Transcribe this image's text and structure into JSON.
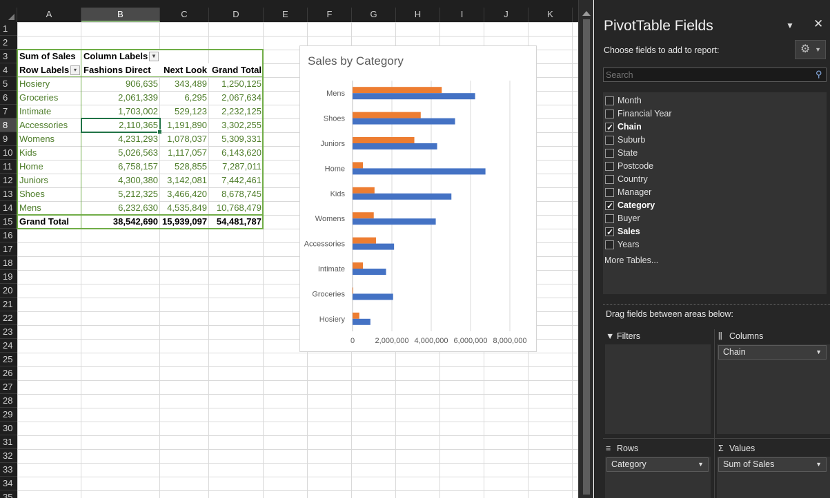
{
  "sheet": {
    "columns": [
      "A",
      "B",
      "C",
      "D",
      "E",
      "F",
      "G",
      "H",
      "I",
      "J",
      "K"
    ],
    "rows": [
      "1",
      "2",
      "3",
      "4",
      "5",
      "6",
      "7",
      "8",
      "9",
      "10",
      "11",
      "12",
      "13",
      "14",
      "15",
      "16",
      "17",
      "18",
      "19",
      "20",
      "21",
      "22",
      "23",
      "24",
      "25",
      "26",
      "27",
      "28",
      "29",
      "30",
      "31",
      "32",
      "33",
      "34",
      "35"
    ],
    "selected_column": "B",
    "selected_row": "8"
  },
  "pivot": {
    "header_sum": "Sum of Sales",
    "header_column_labels": "Column Labels",
    "header_row_labels": "Row Labels",
    "col1": "Fashions Direct",
    "col2": "Next Look",
    "col3": "Grand Total",
    "rows": [
      {
        "label": "Hosiery",
        "fd": "906,635",
        "nl": "343,489",
        "gt": "1,250,125"
      },
      {
        "label": "Groceries",
        "fd": "2,061,339",
        "nl": "6,295",
        "gt": "2,067,634"
      },
      {
        "label": "Intimate",
        "fd": "1,703,002",
        "nl": "529,123",
        "gt": "2,232,125"
      },
      {
        "label": "Accessories",
        "fd": "2,110,365",
        "nl": "1,191,890",
        "gt": "3,302,255"
      },
      {
        "label": "Womens",
        "fd": "4,231,293",
        "nl": "1,078,037",
        "gt": "5,309,331"
      },
      {
        "label": "Kids",
        "fd": "5,026,563",
        "nl": "1,117,057",
        "gt": "6,143,620"
      },
      {
        "label": "Home",
        "fd": "6,758,157",
        "nl": "528,855",
        "gt": "7,287,011"
      },
      {
        "label": "Juniors",
        "fd": "4,300,380",
        "nl": "3,142,081",
        "gt": "7,442,461"
      },
      {
        "label": "Shoes",
        "fd": "5,212,325",
        "nl": "3,466,420",
        "gt": "8,678,745"
      },
      {
        "label": "Mens",
        "fd": "6,232,630",
        "nl": "4,535,849",
        "gt": "10,768,479"
      }
    ],
    "total_label": "Grand Total",
    "total_fd": "38,542,690",
    "total_nl": "15,939,097",
    "total_gt": "54,481,787"
  },
  "chart_data": {
    "type": "bar",
    "orientation": "horizontal",
    "title": "Sales by Category",
    "categories": [
      "Mens",
      "Shoes",
      "Juniors",
      "Home",
      "Kids",
      "Womens",
      "Accessories",
      "Intimate",
      "Groceries",
      "Hosiery"
    ],
    "series": [
      {
        "color": "#ed7d31",
        "values": [
          4535849,
          3466420,
          3142081,
          528855,
          1117057,
          1078037,
          1191890,
          529123,
          6295,
          343489
        ]
      },
      {
        "color": "#4472c4",
        "values": [
          6232630,
          5212325,
          4300380,
          6758157,
          5026563,
          4231293,
          2110365,
          1703002,
          2061339,
          906635
        ]
      }
    ],
    "xlim": [
      0,
      8000000
    ],
    "xticks": [
      "0",
      "2,000,000",
      "4,000,000",
      "6,000,000",
      "8,000,000"
    ],
    "xtick_values": [
      0,
      2000000,
      4000000,
      6000000,
      8000000
    ],
    "grid": true,
    "legend": "none"
  },
  "pane": {
    "title": "PivotTable Fields",
    "choose_label": "Choose fields to add to report:",
    "search_placeholder": "Search",
    "fields": [
      {
        "name": "Month",
        "checked": false
      },
      {
        "name": "Financial Year",
        "checked": false
      },
      {
        "name": "Chain",
        "checked": true
      },
      {
        "name": "Suburb",
        "checked": false
      },
      {
        "name": "State",
        "checked": false
      },
      {
        "name": "Postcode",
        "checked": false
      },
      {
        "name": "Country",
        "checked": false
      },
      {
        "name": "Manager",
        "checked": false
      },
      {
        "name": "Category",
        "checked": true
      },
      {
        "name": "Buyer",
        "checked": false
      },
      {
        "name": "Sales",
        "checked": true
      },
      {
        "name": "Years",
        "checked": false
      }
    ],
    "more_tables": "More Tables...",
    "drag_label": "Drag fields between areas below:",
    "filters_label": "Filters",
    "columns_label": "Columns",
    "rows_label": "Rows",
    "values_label": "Values",
    "columns_chip": "Chain",
    "rows_chip": "Category",
    "values_chip": "Sum of Sales"
  }
}
